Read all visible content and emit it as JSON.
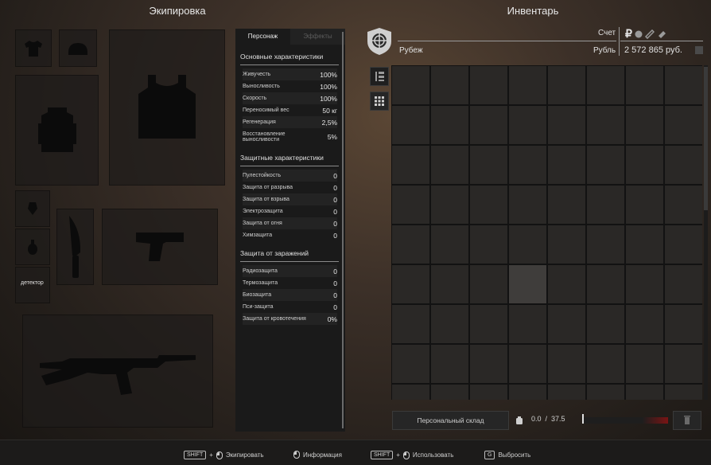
{
  "equipment": {
    "title": "Экипировка",
    "detector_label": "детектор"
  },
  "stats": {
    "tabs": [
      "Персонаж",
      "Эффекты"
    ],
    "main_title": "Основные характеристики",
    "main": [
      {
        "label": "Живучесть",
        "value": "100%"
      },
      {
        "label": "Выносливость",
        "value": "100%"
      },
      {
        "label": "Скорость",
        "value": "100%"
      },
      {
        "label": "Переносимый вес",
        "value": "50 кг"
      },
      {
        "label": "Регенерация",
        "value": "2,5%"
      },
      {
        "label": "Восстановление выносливости",
        "value": "5%"
      }
    ],
    "protect_title": "Защитные характеристики",
    "protect": [
      {
        "label": "Пулестойкость",
        "value": "0"
      },
      {
        "label": "Защита от разрыва",
        "value": "0"
      },
      {
        "label": "Защита от взрыва",
        "value": "0"
      },
      {
        "label": "Электрозащита",
        "value": "0"
      },
      {
        "label": "Защита от огня",
        "value": "0"
      },
      {
        "label": "Химзащита",
        "value": "0"
      }
    ],
    "infect_title": "Защита от заражений",
    "infect": [
      {
        "label": "Радиозащита",
        "value": "0"
      },
      {
        "label": "Термозащита",
        "value": "0"
      },
      {
        "label": "Биозащита",
        "value": "0"
      },
      {
        "label": "Пси-защита",
        "value": "0"
      },
      {
        "label": "Защита от кровотечения",
        "value": "0%"
      }
    ]
  },
  "inventory": {
    "title": "Инвентарь",
    "account_label": "Счет",
    "location": "Рубеж",
    "currency_label": "Рубль",
    "balance": "2 572 865 руб.",
    "storage_button": "Персональный склад",
    "weight_current": "0.0",
    "weight_separator": "/",
    "weight_max": "37.5",
    "weight_fraction": 0.0
  },
  "hints": {
    "shift": "SHIFT",
    "plus": "+",
    "equip": "Экипировать",
    "info": "Информация",
    "use": "Использовать",
    "drop_key": "G",
    "drop": "Выбросить"
  },
  "colors": {
    "accent_red": "#8b1a1a",
    "slot_bg": "#1e1c1a",
    "panel_bg": "#1a1a1a"
  }
}
